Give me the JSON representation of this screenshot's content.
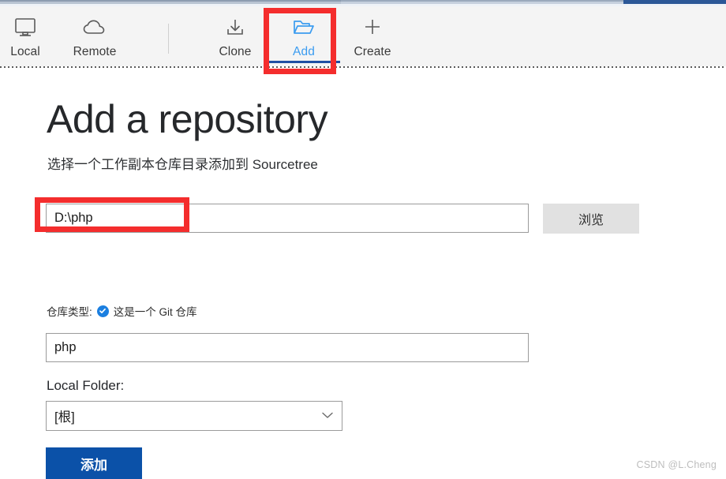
{
  "window": {
    "chrome_visible": true
  },
  "toolbar": {
    "items": [
      {
        "id": "local",
        "label": "Local",
        "icon": "monitor-icon",
        "active": false
      },
      {
        "id": "remote",
        "label": "Remote",
        "icon": "cloud-icon",
        "active": false
      },
      {
        "id": "clone",
        "label": "Clone",
        "icon": "download-icon",
        "active": false
      },
      {
        "id": "add",
        "label": "Add",
        "icon": "folder-open-icon",
        "active": true
      },
      {
        "id": "create",
        "label": "Create",
        "icon": "plus-icon",
        "active": false
      }
    ]
  },
  "main": {
    "title": "Add a repository",
    "subtitle": "选择一个工作副本仓库目录添加到 Sourcetree",
    "path_field": {
      "value": "D:\\php",
      "placeholder": ""
    },
    "browse_button": "浏览",
    "repo_type": {
      "label": "仓库类型:",
      "badge_icon": "check-badge-icon",
      "value": "这是一个 Git 仓库"
    },
    "name_field": {
      "value": "php",
      "placeholder": ""
    },
    "local_folder": {
      "label": "Local Folder:",
      "selected": "[根]",
      "chevron_icon": "chevron-down-icon"
    },
    "submit_button": "添加"
  },
  "watermark": "CSDN @L.Cheng",
  "colors": {
    "accent_blue": "#3b9cf0",
    "active_underline": "#1f4fa3",
    "primary_button": "#0b51a8",
    "annotation_red": "#f42d2d",
    "toolbar_bg": "#f4f4f4",
    "badge_blue": "#1b7fe0"
  }
}
